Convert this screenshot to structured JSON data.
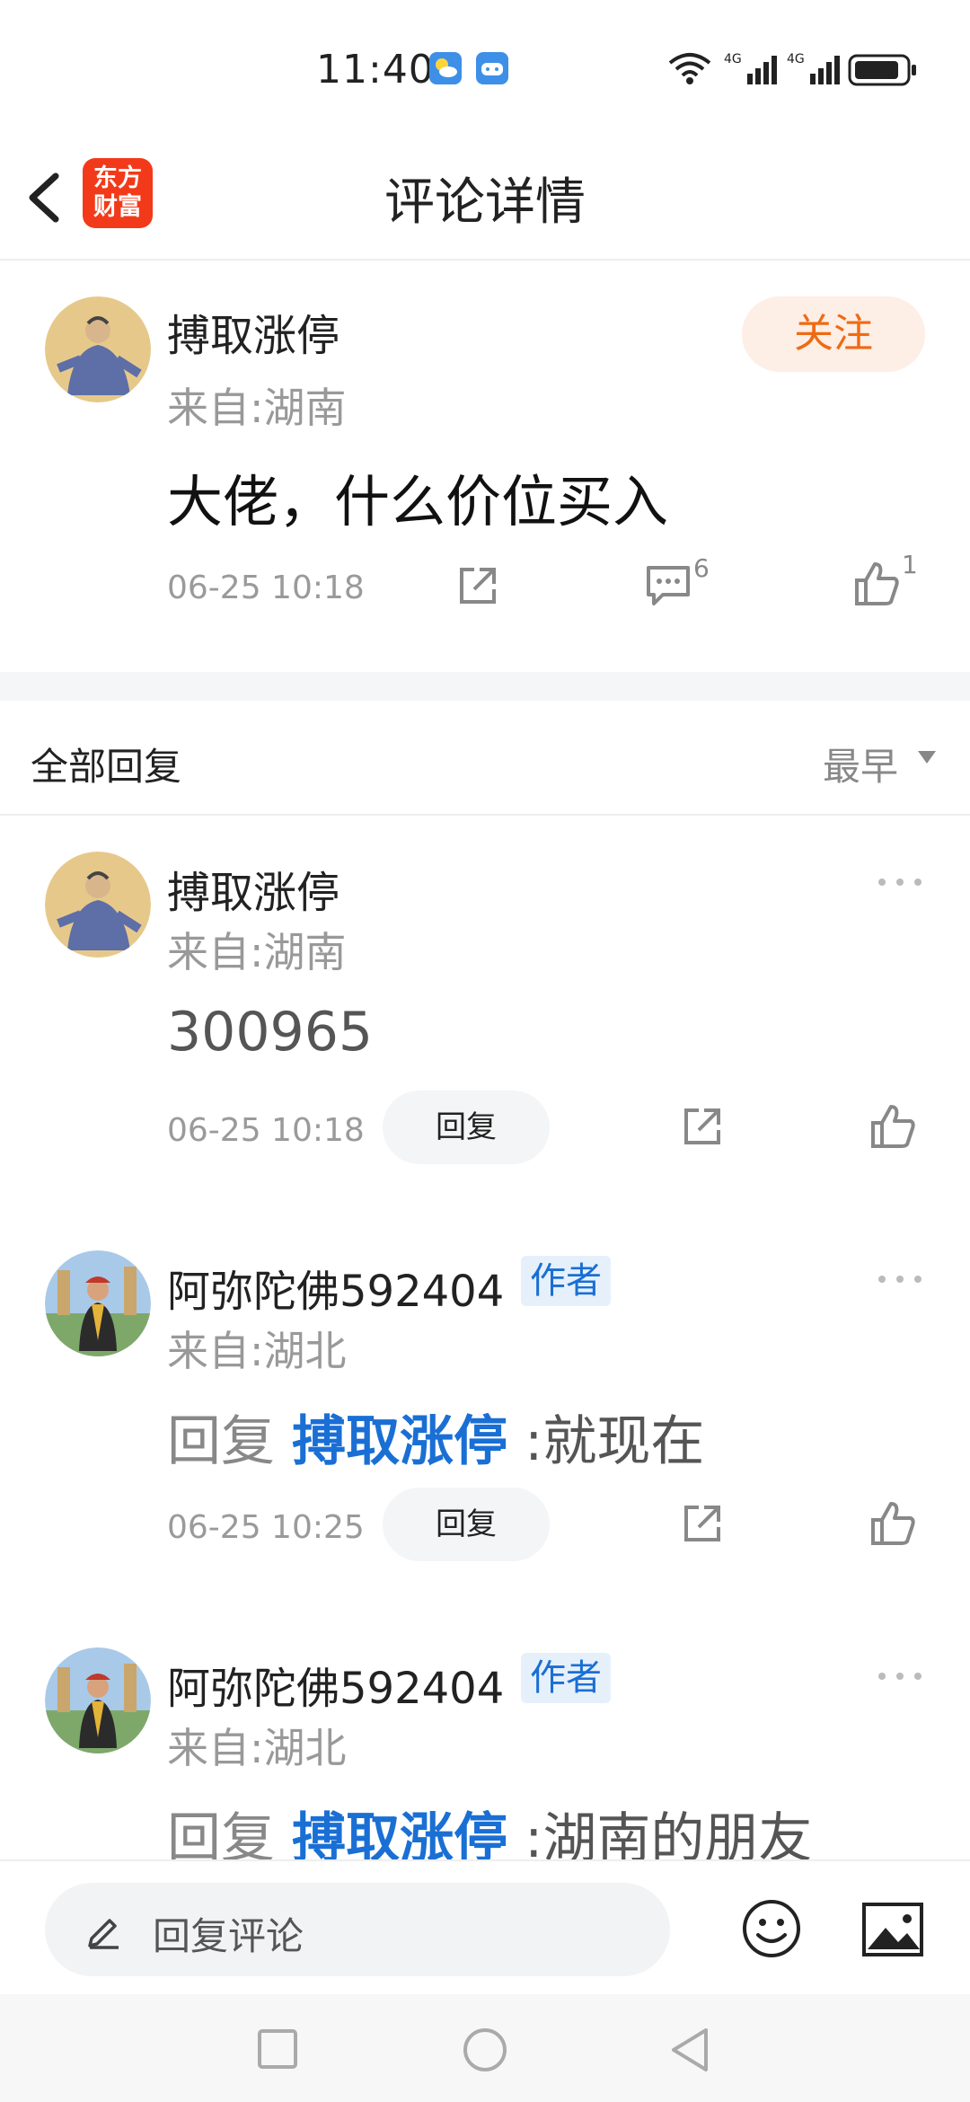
{
  "status_bar": {
    "time": "11:40"
  },
  "header": {
    "title": "评论详情",
    "logo_line1": "东方",
    "logo_line2": "财富"
  },
  "main_comment": {
    "username": "搏取涨停",
    "location": "来自:湖南",
    "follow_label": "关注",
    "content": "大佬，什么价位买入",
    "timestamp": "06-25 10:18",
    "comment_count": "6",
    "like_count": "1"
  },
  "replies_header": {
    "title": "全部回复",
    "sort_label": "最早"
  },
  "replies": [
    {
      "username": "搏取涨停",
      "location": "来自:湖南",
      "content": "300965",
      "timestamp": "06-25 10:18",
      "reply_label": "回复"
    },
    {
      "username": "阿弥陀佛592404",
      "badge": "作者",
      "location": "来自:湖北",
      "prefix": "回复",
      "mention": "搏取涨停",
      "colon": ":",
      "text": "就现在",
      "timestamp": "06-25 10:25",
      "reply_label": "回复"
    },
    {
      "username": "阿弥陀佛592404",
      "badge": "作者",
      "location": "来自:湖北",
      "prefix": "回复",
      "mention": "搏取涨停",
      "colon": ":",
      "text": "湖南的朋友"
    }
  ],
  "bottom_bar": {
    "input_placeholder": "回复评论"
  },
  "colors": {
    "accent_orange": "#f06a12",
    "mention_blue": "#1a6fd4",
    "logo_red": "#f23a1a"
  }
}
